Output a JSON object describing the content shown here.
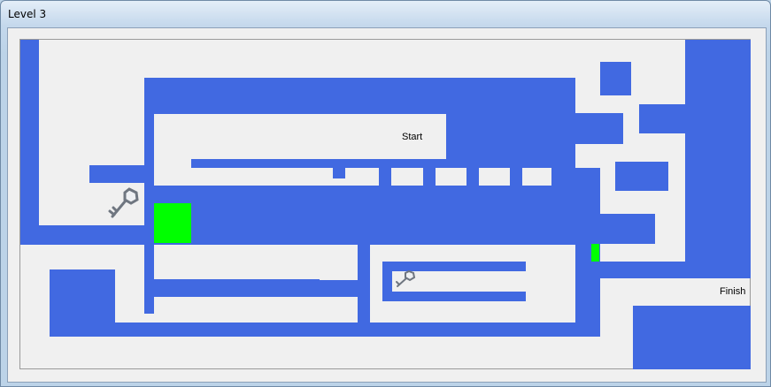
{
  "window": {
    "title": "Level 3"
  },
  "maze": {
    "start_label": "Start",
    "finish_label": "Finish",
    "wall_color": "#4169e1",
    "floor_color": "#f0f0f0",
    "gate_color": "#00ff00",
    "items": [
      "key-icon",
      "key-icon"
    ]
  }
}
